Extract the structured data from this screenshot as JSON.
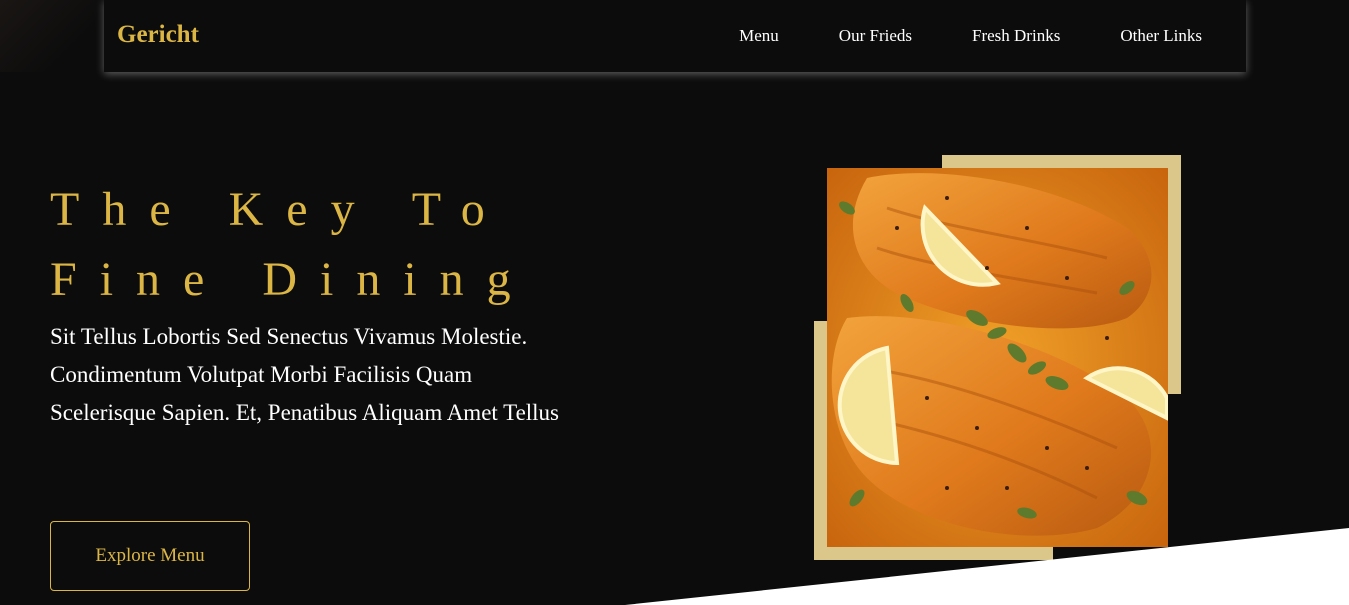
{
  "brand": {
    "name": "Gericht"
  },
  "nav": {
    "items": [
      "Menu",
      "Our Frieds",
      "Fresh Drinks",
      "Other Links"
    ]
  },
  "hero": {
    "title_line1": "The Key To",
    "title_line2": "Fine Dining",
    "description": "Sit Tellus Lobortis Sed Senectus Vivamus Molestie. Condimentum Volutpat Morbi Facilisis Quam Scelerisque Sapien. Et, Penatibus Aliquam Amet Tellus",
    "cta_label": "Explore Menu"
  },
  "colors": {
    "accent": "#dcb645",
    "frame": "#dcc78a",
    "background": "#0c0c0c"
  }
}
